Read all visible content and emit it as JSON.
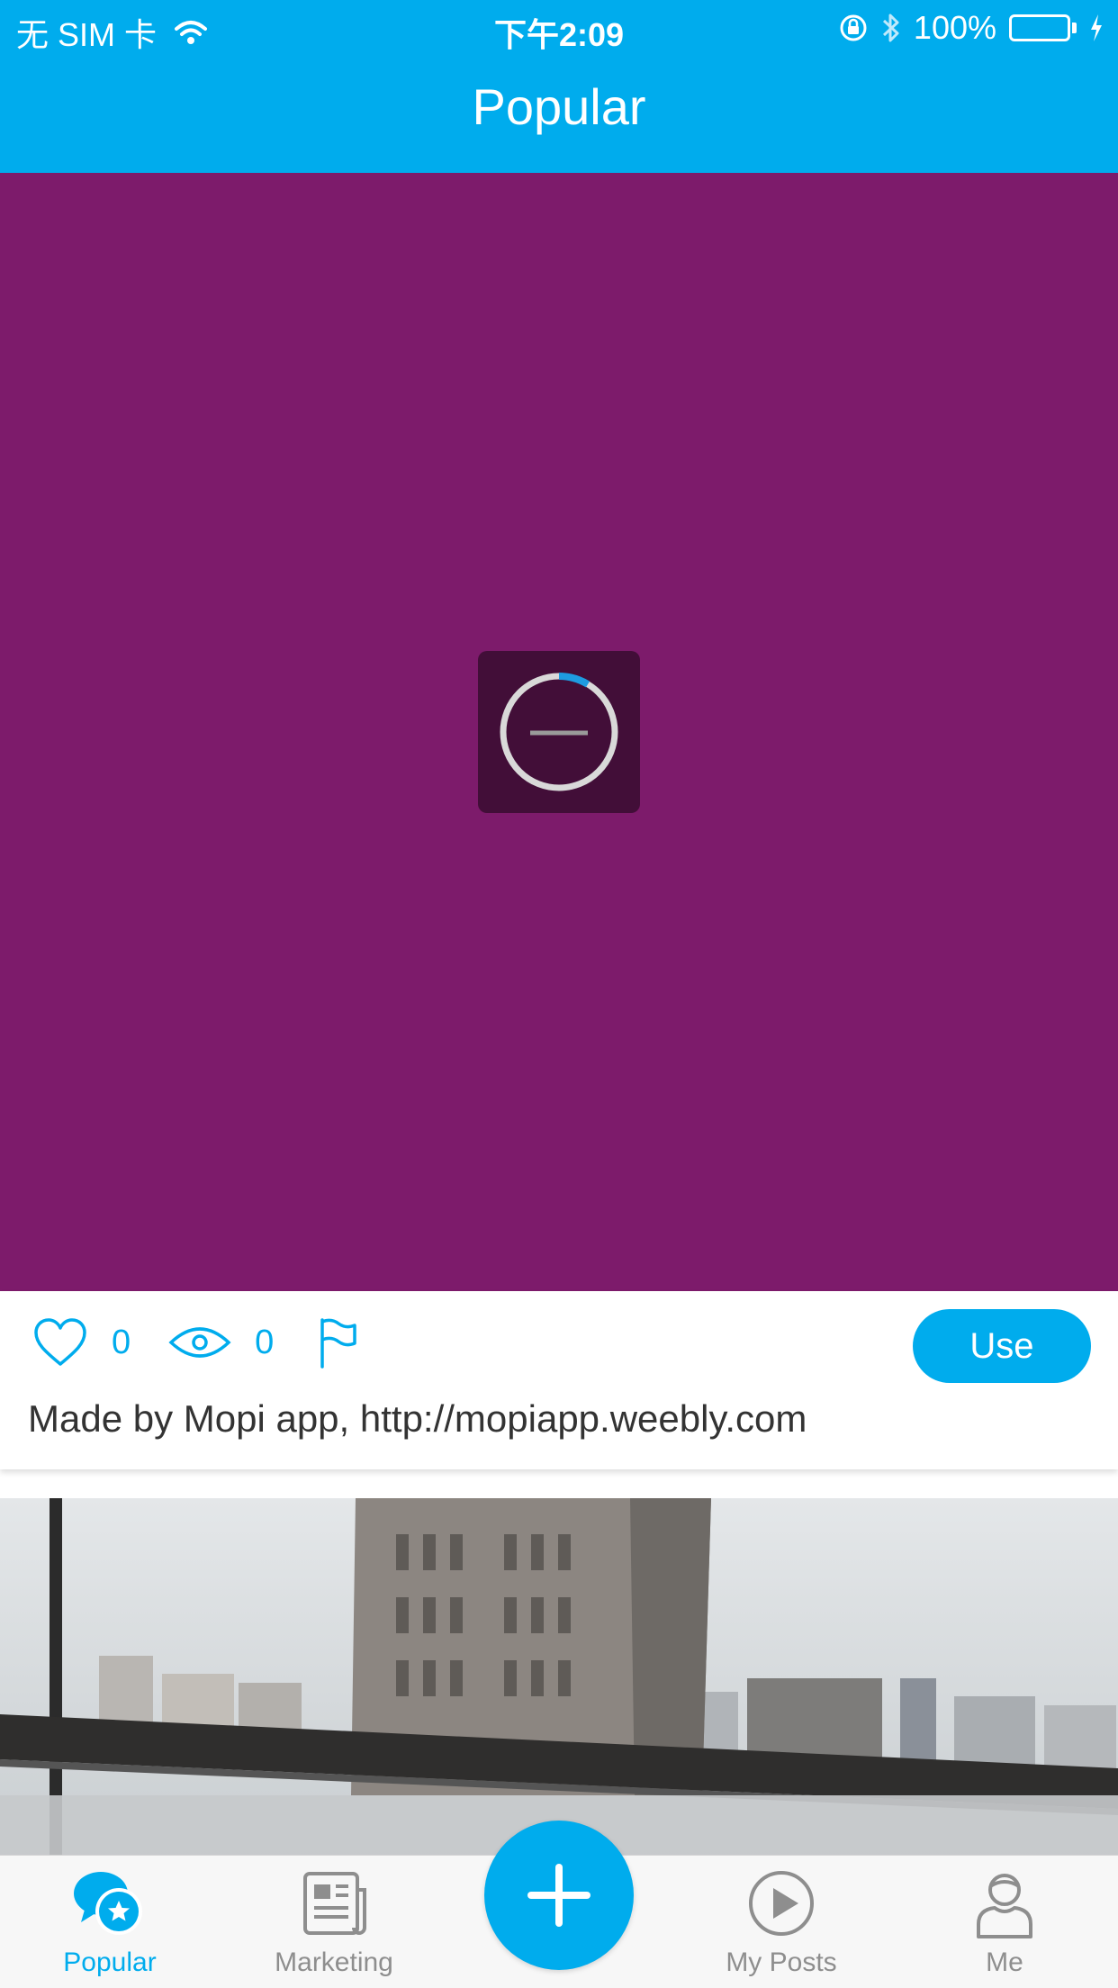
{
  "status_bar": {
    "carrier": "无 SIM 卡",
    "time": "下午2:09",
    "battery_percent": "100%",
    "battery_level": 1.0
  },
  "nav": {
    "title": "Popular"
  },
  "post": {
    "media_color": "#7d1b6b",
    "like_count": "0",
    "view_count": "0",
    "use_label": "Use",
    "caption": "Made by Mopi app, http://mopiapp.weebly.com"
  },
  "tabs": [
    {
      "label": "Popular",
      "icon": "chat-star-icon",
      "active": true
    },
    {
      "label": "Marketing",
      "icon": "newspaper-icon",
      "active": false
    },
    {
      "label": "My Posts",
      "icon": "play-icon",
      "active": false
    },
    {
      "label": "Me",
      "icon": "user-icon",
      "active": false
    }
  ],
  "fab": {
    "icon": "plus-icon"
  },
  "colors": {
    "accent": "#00aced",
    "tab_inactive": "#8e8e8e"
  }
}
